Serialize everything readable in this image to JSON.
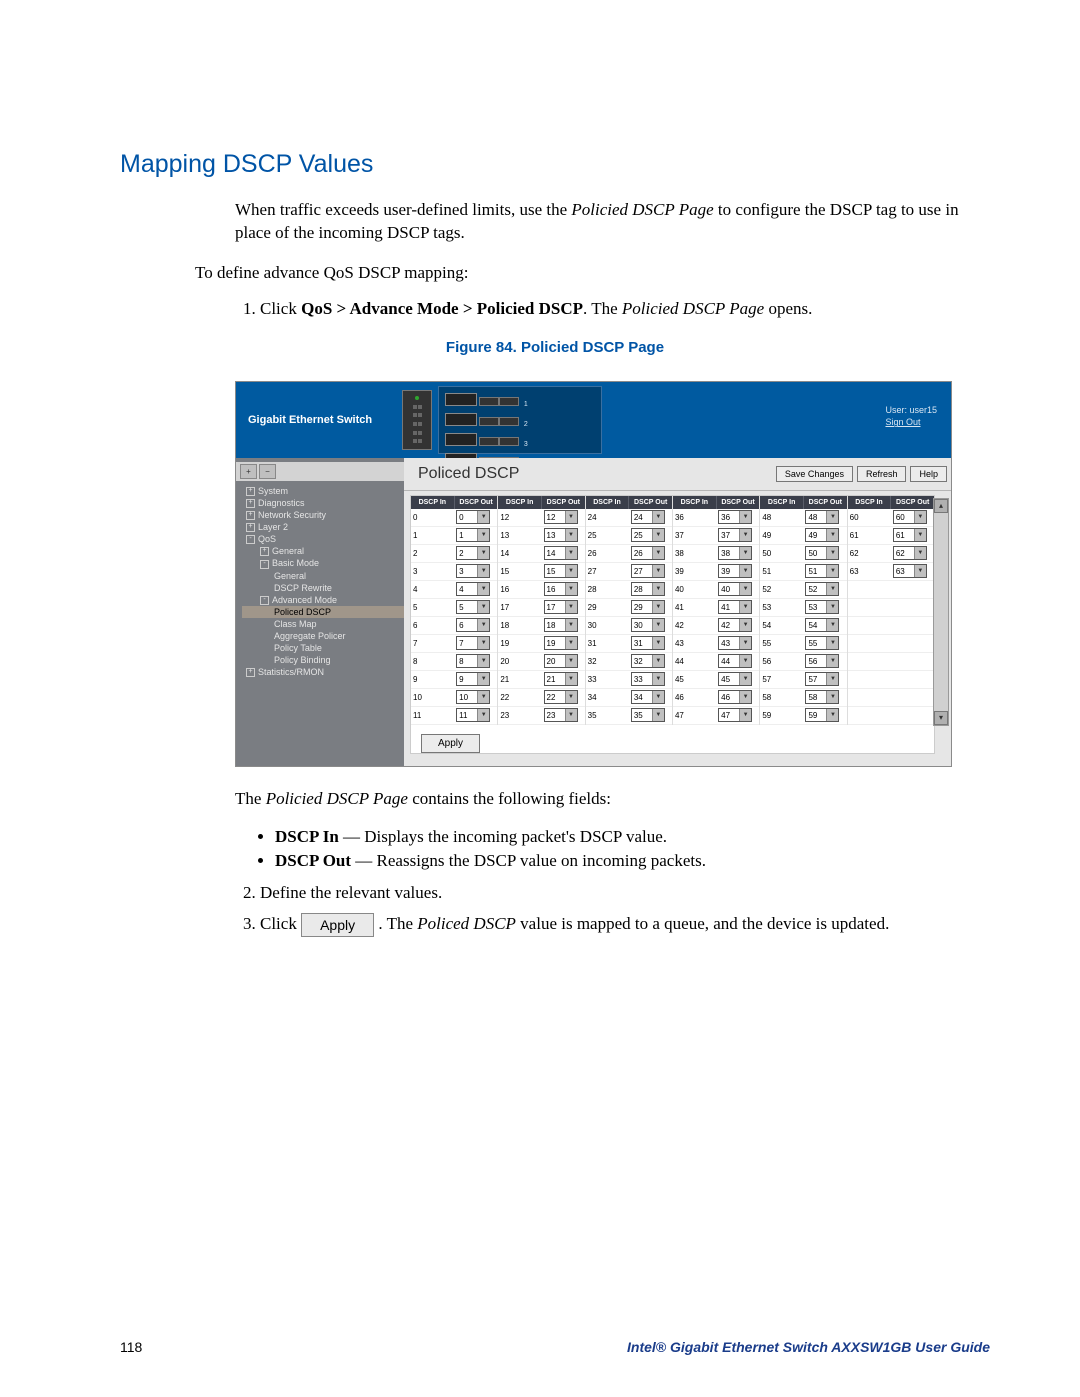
{
  "heading": "Mapping DSCP Values",
  "intro_part1": "When traffic exceeds user-defined limits, use the ",
  "intro_em1": "Policied DSCP Page",
  "intro_part2": " to configure the DSCP tag to use in place of the incoming DSCP tags.",
  "step_intro": "To define advance QoS DSCP mapping:",
  "step1_a": "Click ",
  "step1_b": "QoS > Advance Mode > Policied DSCP",
  "step1_c": ". The ",
  "step1_d": "Policied DSCP Page",
  "step1_e": " opens.",
  "fig_caption": "Figure 84. Policied DSCP Page",
  "screenshot": {
    "brand": "Gigabit Ethernet Switch",
    "user_label": "User: user15",
    "signout": "Sign Out",
    "main_title": "Policed DSCP",
    "btn_save": "Save Changes",
    "btn_refresh": "Refresh",
    "btn_help": "Help",
    "btn_apply": "Apply",
    "col_in": "DSCP In",
    "col_out": "DSCP Out",
    "tree": [
      {
        "lvl": 1,
        "label": "System",
        "exp": "+"
      },
      {
        "lvl": 1,
        "label": "Diagnostics",
        "exp": "+"
      },
      {
        "lvl": 1,
        "label": "Network Security",
        "exp": "+"
      },
      {
        "lvl": 1,
        "label": "Layer 2",
        "exp": "+"
      },
      {
        "lvl": 1,
        "label": "QoS",
        "exp": "-"
      },
      {
        "lvl": 2,
        "label": "General",
        "exp": "+"
      },
      {
        "lvl": 2,
        "label": "Basic Mode",
        "exp": "-"
      },
      {
        "lvl": 3,
        "label": "General"
      },
      {
        "lvl": 3,
        "label": "DSCP Rewrite"
      },
      {
        "lvl": 2,
        "label": "Advanced Mode",
        "exp": "-"
      },
      {
        "lvl": 3,
        "label": "Policed DSCP",
        "selected": true
      },
      {
        "lvl": 3,
        "label": "Class Map"
      },
      {
        "lvl": 3,
        "label": "Aggregate Policer"
      },
      {
        "lvl": 3,
        "label": "Policy Table"
      },
      {
        "lvl": 3,
        "label": "Policy Binding"
      },
      {
        "lvl": 1,
        "label": "Statistics/RMON",
        "exp": "+"
      }
    ],
    "columns": [
      {
        "start": 0,
        "count": 12
      },
      {
        "start": 12,
        "count": 12
      },
      {
        "start": 24,
        "count": 12
      },
      {
        "start": 36,
        "count": 12
      },
      {
        "start": 48,
        "count": 12
      },
      {
        "start": 60,
        "count": 4
      }
    ]
  },
  "after1_a": "The ",
  "after1_b": "Policied DSCP Page",
  "after1_c": " contains the following fields:",
  "bullet1_a": "DSCP In",
  "bullet1_b": " — Displays the incoming packet's DSCP value.",
  "bullet2_a": "DSCP Out",
  "bullet2_b": " — Reassigns the DSCP value on incoming packets.",
  "step2": "Define the relevant values.",
  "step3_a": "Click ",
  "step3_apply": "Apply",
  "step3_b": " . The ",
  "step3_c": "Policed DSCP",
  "step3_d": " value is mapped to a queue, and the device is updated.",
  "footer_page": "118",
  "footer_guide": "Intel® Gigabit Ethernet Switch AXXSW1GB User Guide"
}
